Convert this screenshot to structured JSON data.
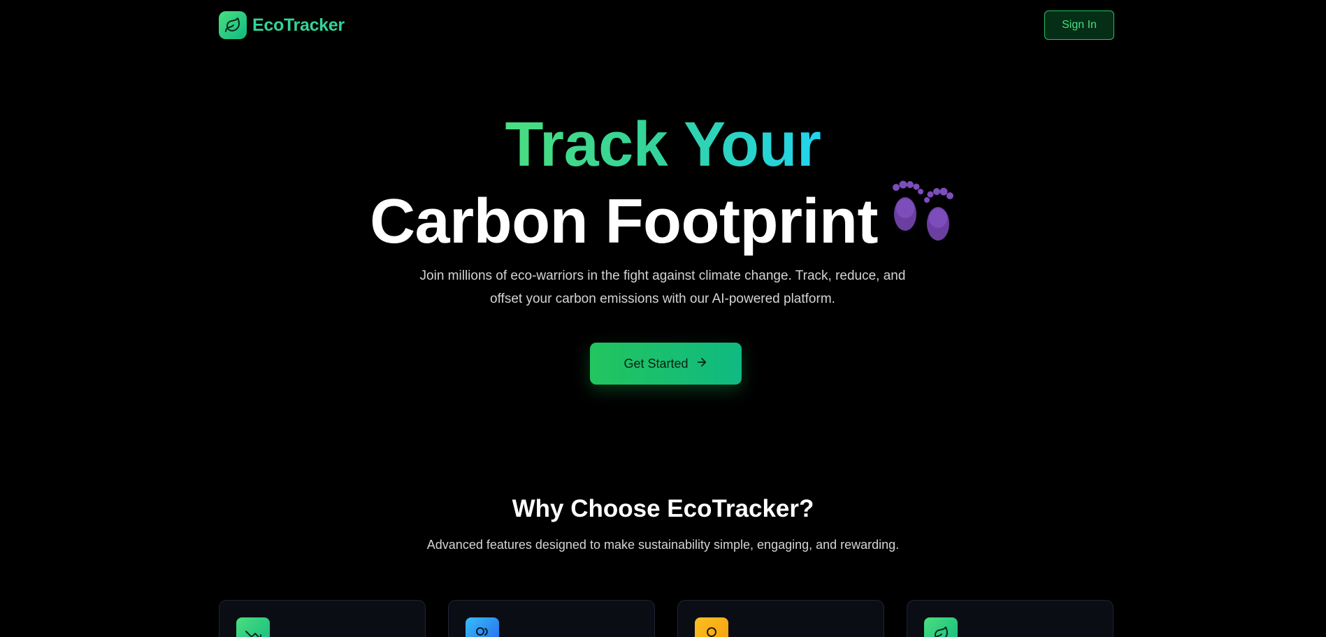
{
  "header": {
    "brand_name": "EcoTracker",
    "logo_icon": "leaf-icon",
    "signin_label": "Sign In"
  },
  "hero": {
    "title_line1": "Track Your",
    "title_line2": "Carbon Footprint",
    "title_emoji_icon": "footprints-icon",
    "subtitle_line1": "Join millions of eco-warriors in the fight against climate change. Track, reduce, and",
    "subtitle_line2": "offset your carbon emissions with our AI-powered platform.",
    "cta_label": "Get Started",
    "cta_icon": "arrow-right-icon"
  },
  "features": {
    "title": "Why Choose EcoTracker?",
    "subtitle": "Advanced features designed to make sustainability simple, engaging, and rewarding.",
    "cards": [
      {
        "icon": "trending-down-icon",
        "color": "#34d399"
      },
      {
        "icon": "users-icon",
        "color": "#3b82f6"
      },
      {
        "icon": "award-icon",
        "color": "#f59e0b"
      },
      {
        "icon": "leaf-icon",
        "color": "#34d399"
      }
    ]
  },
  "colors": {
    "accent_green": "#22c55e",
    "accent_teal": "#10b981",
    "accent_cyan": "#22d3ee",
    "background": "#000000"
  }
}
